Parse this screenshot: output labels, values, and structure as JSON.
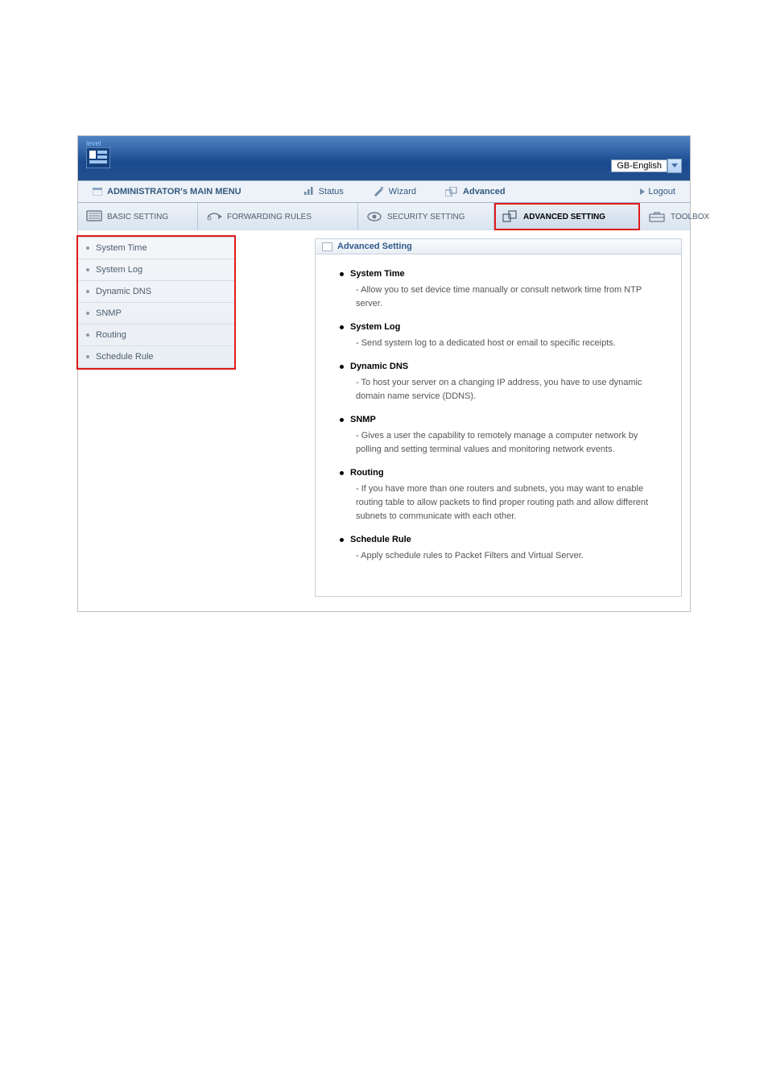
{
  "logo_text": "level",
  "lang": {
    "selected": "GB-English"
  },
  "topnav": {
    "title": "ADMINISTRATOR's MAIN MENU",
    "status": "Status",
    "wizard": "Wizard",
    "advanced": "Advanced",
    "logout": "Logout"
  },
  "tabs": {
    "basic": "BASIC SETTING",
    "forwarding": "FORWARDING RULES",
    "security": "SECURITY SETTING",
    "advanced": "ADVANCED SETTING",
    "toolbox": "TOOLBOX"
  },
  "sidebar": {
    "items": [
      {
        "label": "System Time"
      },
      {
        "label": "System Log"
      },
      {
        "label": "Dynamic DNS"
      },
      {
        "label": "SNMP"
      },
      {
        "label": "Routing"
      },
      {
        "label": "Schedule Rule"
      }
    ]
  },
  "panel": {
    "heading": "Advanced Setting",
    "features": [
      {
        "title": "System Time",
        "desc": "- Allow you to set device time manually or consult network time from NTP server."
      },
      {
        "title": "System Log",
        "desc": "- Send system log to a dedicated host or email to specific receipts."
      },
      {
        "title": "Dynamic DNS",
        "desc": "- To host your server on a changing IP address, you have to use dynamic domain name service (DDNS)."
      },
      {
        "title": "SNMP",
        "desc": "- Gives a user the capability to remotely manage a computer network by polling and setting terminal values and monitoring network events."
      },
      {
        "title": "Routing",
        "desc": "- If you have more than one routers and subnets, you may want to enable routing table to allow packets to find proper routing path and allow different subnets to communicate with each other."
      },
      {
        "title": "Schedule Rule",
        "desc": "- Apply schedule rules to Packet Filters and Virtual Server."
      }
    ]
  }
}
